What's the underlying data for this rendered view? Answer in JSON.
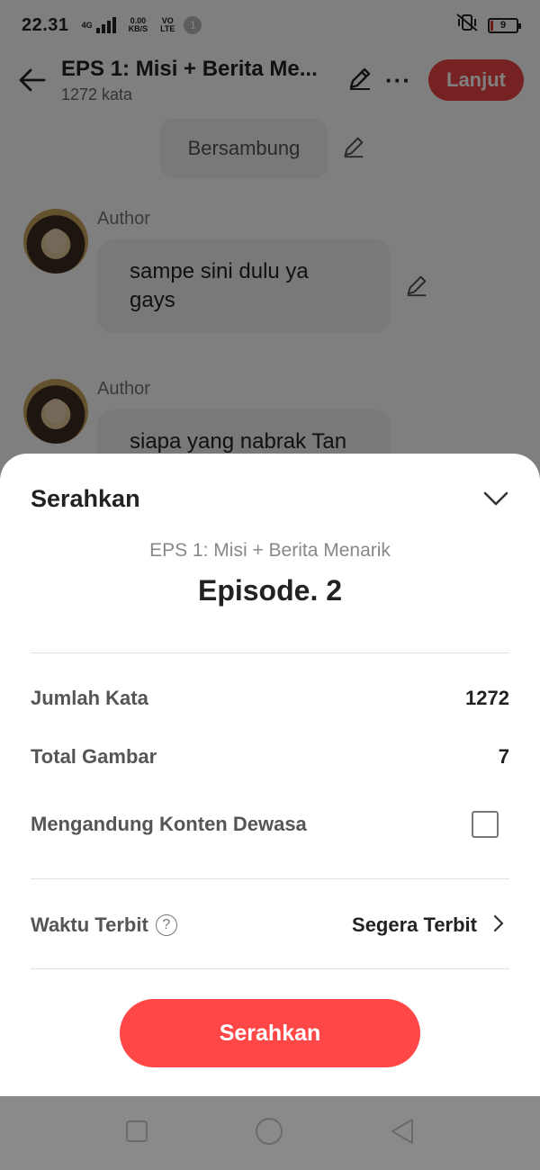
{
  "status_bar": {
    "time": "22.31",
    "network_speed": "0.00",
    "network_speed_unit": "KB/S",
    "vo": "VO",
    "lte": "LTE",
    "signal_label": "4G",
    "notification_count": "1",
    "battery": "9",
    "battery_color": "#e53935"
  },
  "header": {
    "title": "EPS 1: Misi + Berita Me...",
    "subtitle": "1272 kata",
    "next_label": "Lanjut",
    "accent": "#ef4444"
  },
  "chat": {
    "continued_label": "Bersambung",
    "messages": [
      {
        "author": "Author",
        "text": "sampe sini dulu ya gays"
      },
      {
        "author": "Author",
        "text": "siapa yang nabrak Tan"
      }
    ]
  },
  "sheet": {
    "title": "Serahkan",
    "episode_title": "EPS 1: Misi + Berita Menarik",
    "episode_number": "Episode. 2",
    "word_count_label": "Jumlah Kata",
    "word_count": "1272",
    "images_label": "Total Gambar",
    "images_count": "7",
    "adult_label": "Mengandung Konten Dewasa",
    "adult_checked": false,
    "publish_label": "Waktu Terbit",
    "publish_value": "Segera Terbit",
    "submit_label": "Serahkan",
    "submit_color": "#ff4747"
  },
  "icons": {
    "back": "arrow-left",
    "edit": "pencil",
    "more": "ellipsis",
    "collapse": "chevron-down",
    "help": "question-circle",
    "chevron": "chevron-right",
    "nav": [
      "square",
      "circle",
      "triangle-left"
    ]
  }
}
